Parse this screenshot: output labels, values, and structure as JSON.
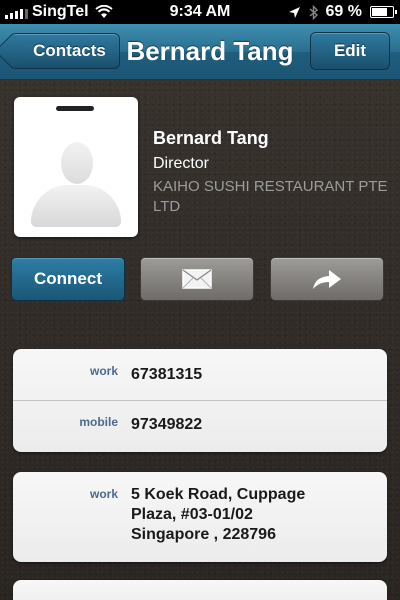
{
  "status_bar": {
    "carrier": "SingTel",
    "time": "9:34 AM",
    "battery_text": "69 %",
    "battery_level": 0.69,
    "icons": [
      "signal-icon",
      "wifi-icon",
      "location-icon",
      "bluetooth-icon",
      "battery-icon"
    ]
  },
  "nav": {
    "back_label": "Contacts",
    "title": "Bernard Tang",
    "edit_label": "Edit"
  },
  "contact": {
    "name": "Bernard Tang",
    "title": "Director",
    "company": "KAIHO SUSHI RESTAURANT PTE LTD"
  },
  "actions": {
    "connect_label": "Connect",
    "mail_icon": "envelope-icon",
    "share_icon": "share-arrow-icon"
  },
  "phones": [
    {
      "label": "work",
      "value": "67381315"
    },
    {
      "label": "mobile",
      "value": "97349822"
    }
  ],
  "address": {
    "label": "work",
    "lines": [
      "5 Koek Road, Cuppage",
      "Plaza, #03-01/02",
      "Singapore , 228796"
    ]
  },
  "colors": {
    "nav_blue": "#2a6f90",
    "label_blue": "#4c6a8e",
    "background": "#2f2a26"
  }
}
